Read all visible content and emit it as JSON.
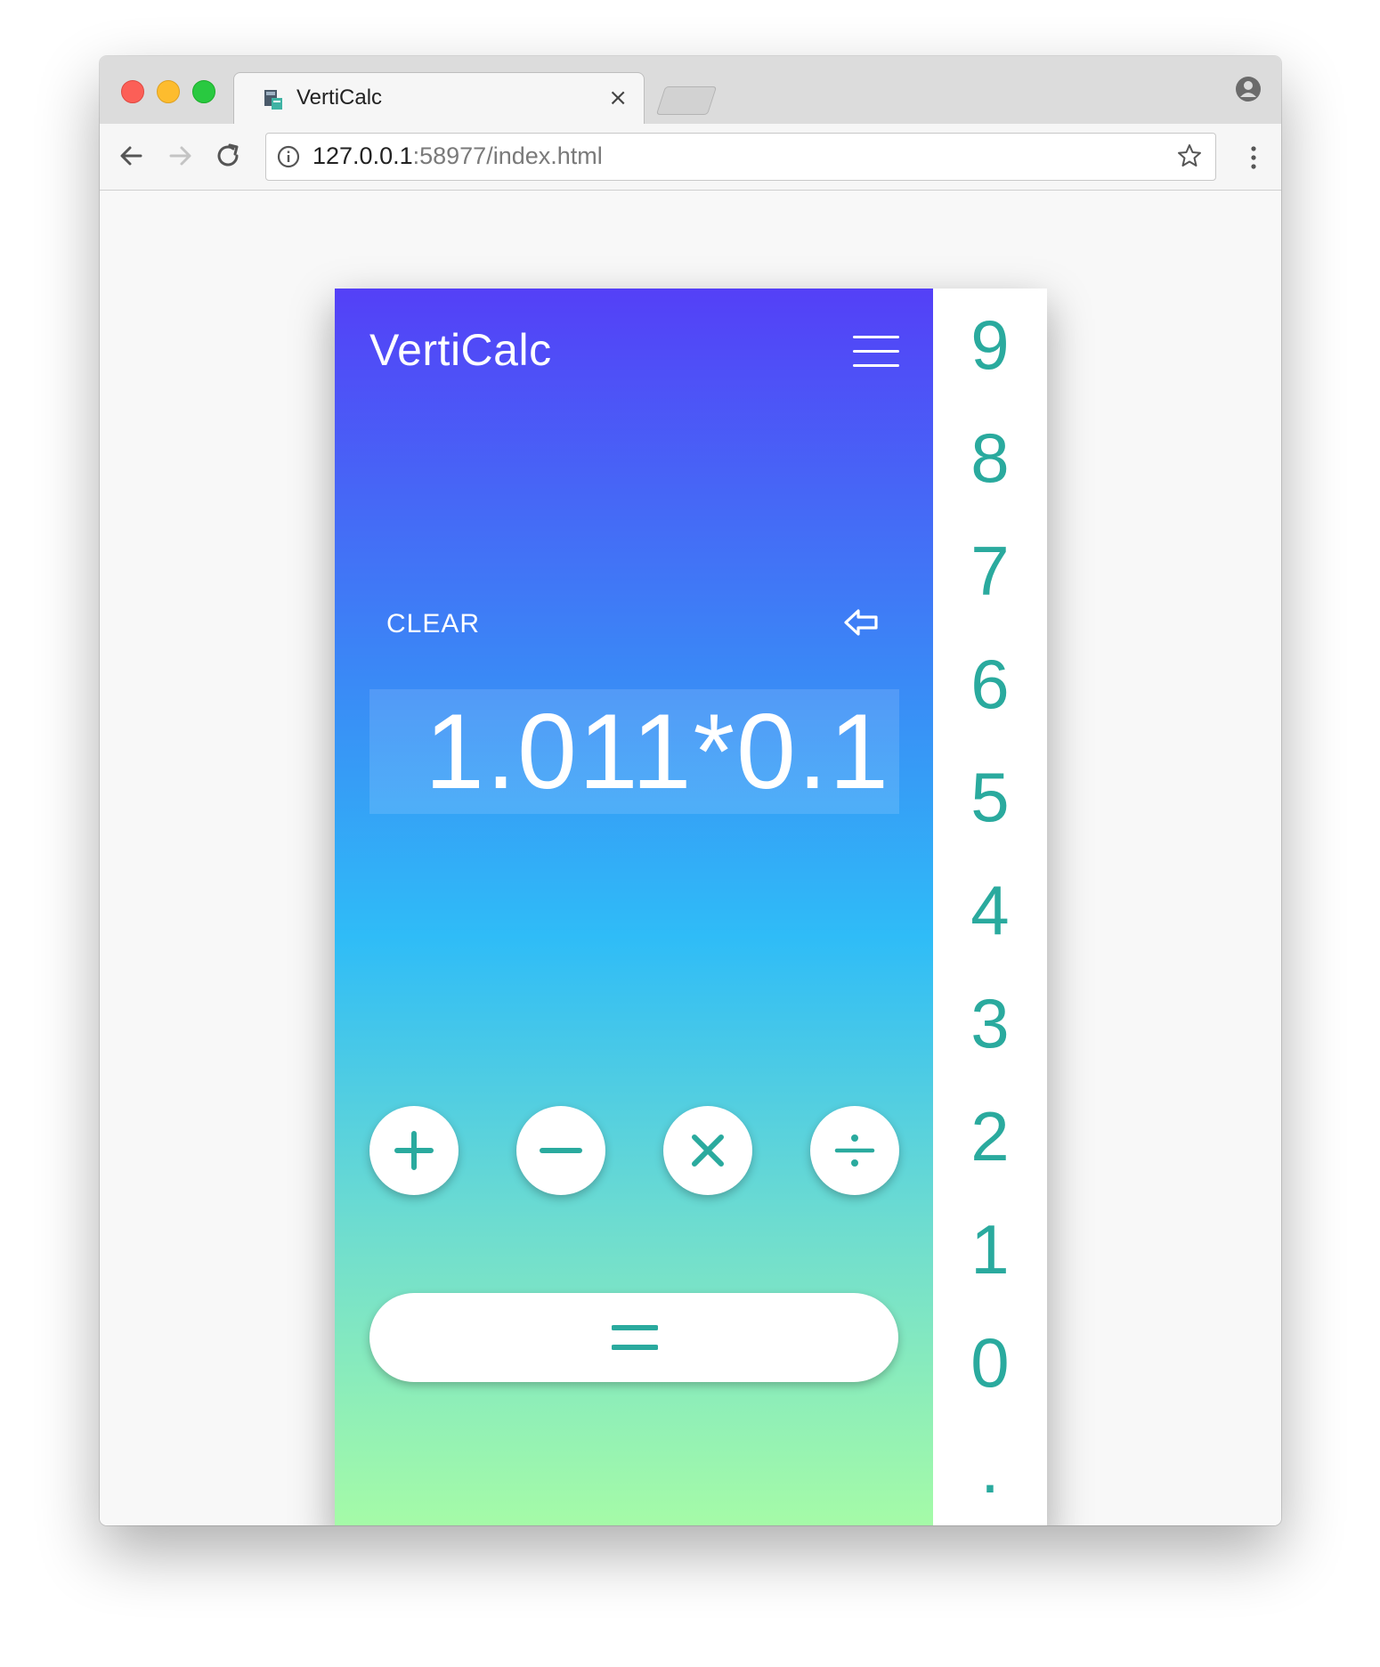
{
  "browser": {
    "tab_title": "VertiCalc",
    "tab_close": "×",
    "url_host": "127.0.0.1",
    "url_rest": ":58977/index.html"
  },
  "app": {
    "title": "VertiCalc",
    "clear_label": "CLEAR",
    "display_value": "1.011*0.1",
    "operators": [
      "plus",
      "minus",
      "multiply",
      "divide"
    ],
    "equals": "equals",
    "digits": [
      "9",
      "8",
      "7",
      "6",
      "5",
      "4",
      "3",
      "2",
      "1",
      "0",
      "."
    ]
  },
  "colors": {
    "accent": "#2aaa9e",
    "gradient_top": "#5440f7",
    "gradient_mid": "#2fbcf7",
    "gradient_bottom": "#a7fca6"
  }
}
